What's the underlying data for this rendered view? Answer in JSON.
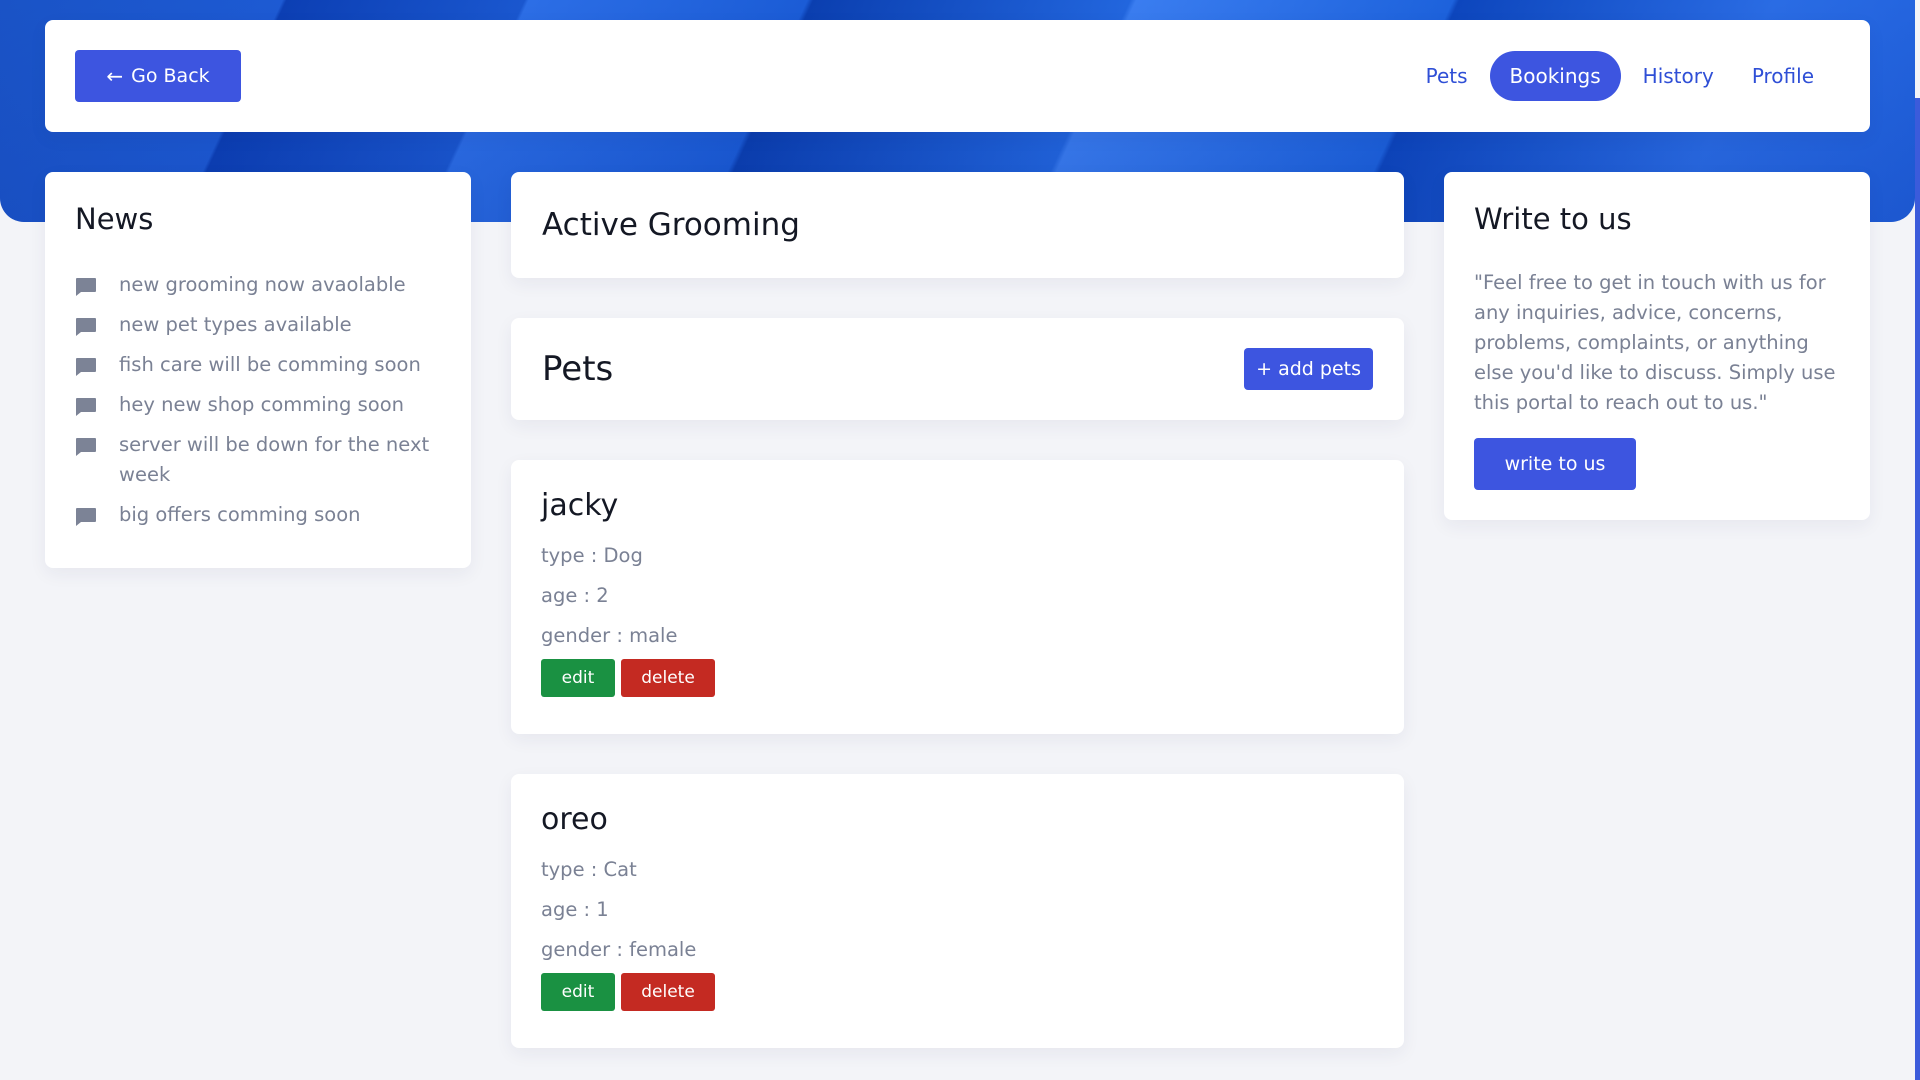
{
  "header": {
    "back_label": "Go Back",
    "nav": [
      {
        "label": "Pets",
        "active": false
      },
      {
        "label": "Bookings",
        "active": true
      },
      {
        "label": "History",
        "active": false
      },
      {
        "label": "Profile",
        "active": false
      }
    ]
  },
  "news": {
    "title": "News",
    "items": [
      "new grooming now avaolable",
      "new pet types available",
      "fish care will be comming soon",
      "hey new shop comming soon",
      "server will be down for the next week",
      "big offers comming soon"
    ]
  },
  "active_grooming": {
    "title": "Active Grooming"
  },
  "pets": {
    "title": "Pets",
    "add_label": "add pets",
    "edit_label": "edit",
    "delete_label": "delete",
    "list": [
      {
        "name": "jacky",
        "type": "type : Dog",
        "age": "age : 2",
        "gender": "gender : male"
      },
      {
        "name": "oreo",
        "type": "type : Cat",
        "age": "age : 1",
        "gender": "gender : female"
      }
    ]
  },
  "write_to_us": {
    "title": "Write to us",
    "text": "\"Feel free to get in touch with us for any inquiries, advice, concerns, problems, complaints, or anything else you'd like to discuss. Simply use this portal to reach out to us.\"",
    "button_label": "write to us"
  },
  "colors": {
    "primary": "#3d55e0",
    "edit": "#1a9142",
    "delete": "#c42a22",
    "hero": "#1d5ad3"
  }
}
